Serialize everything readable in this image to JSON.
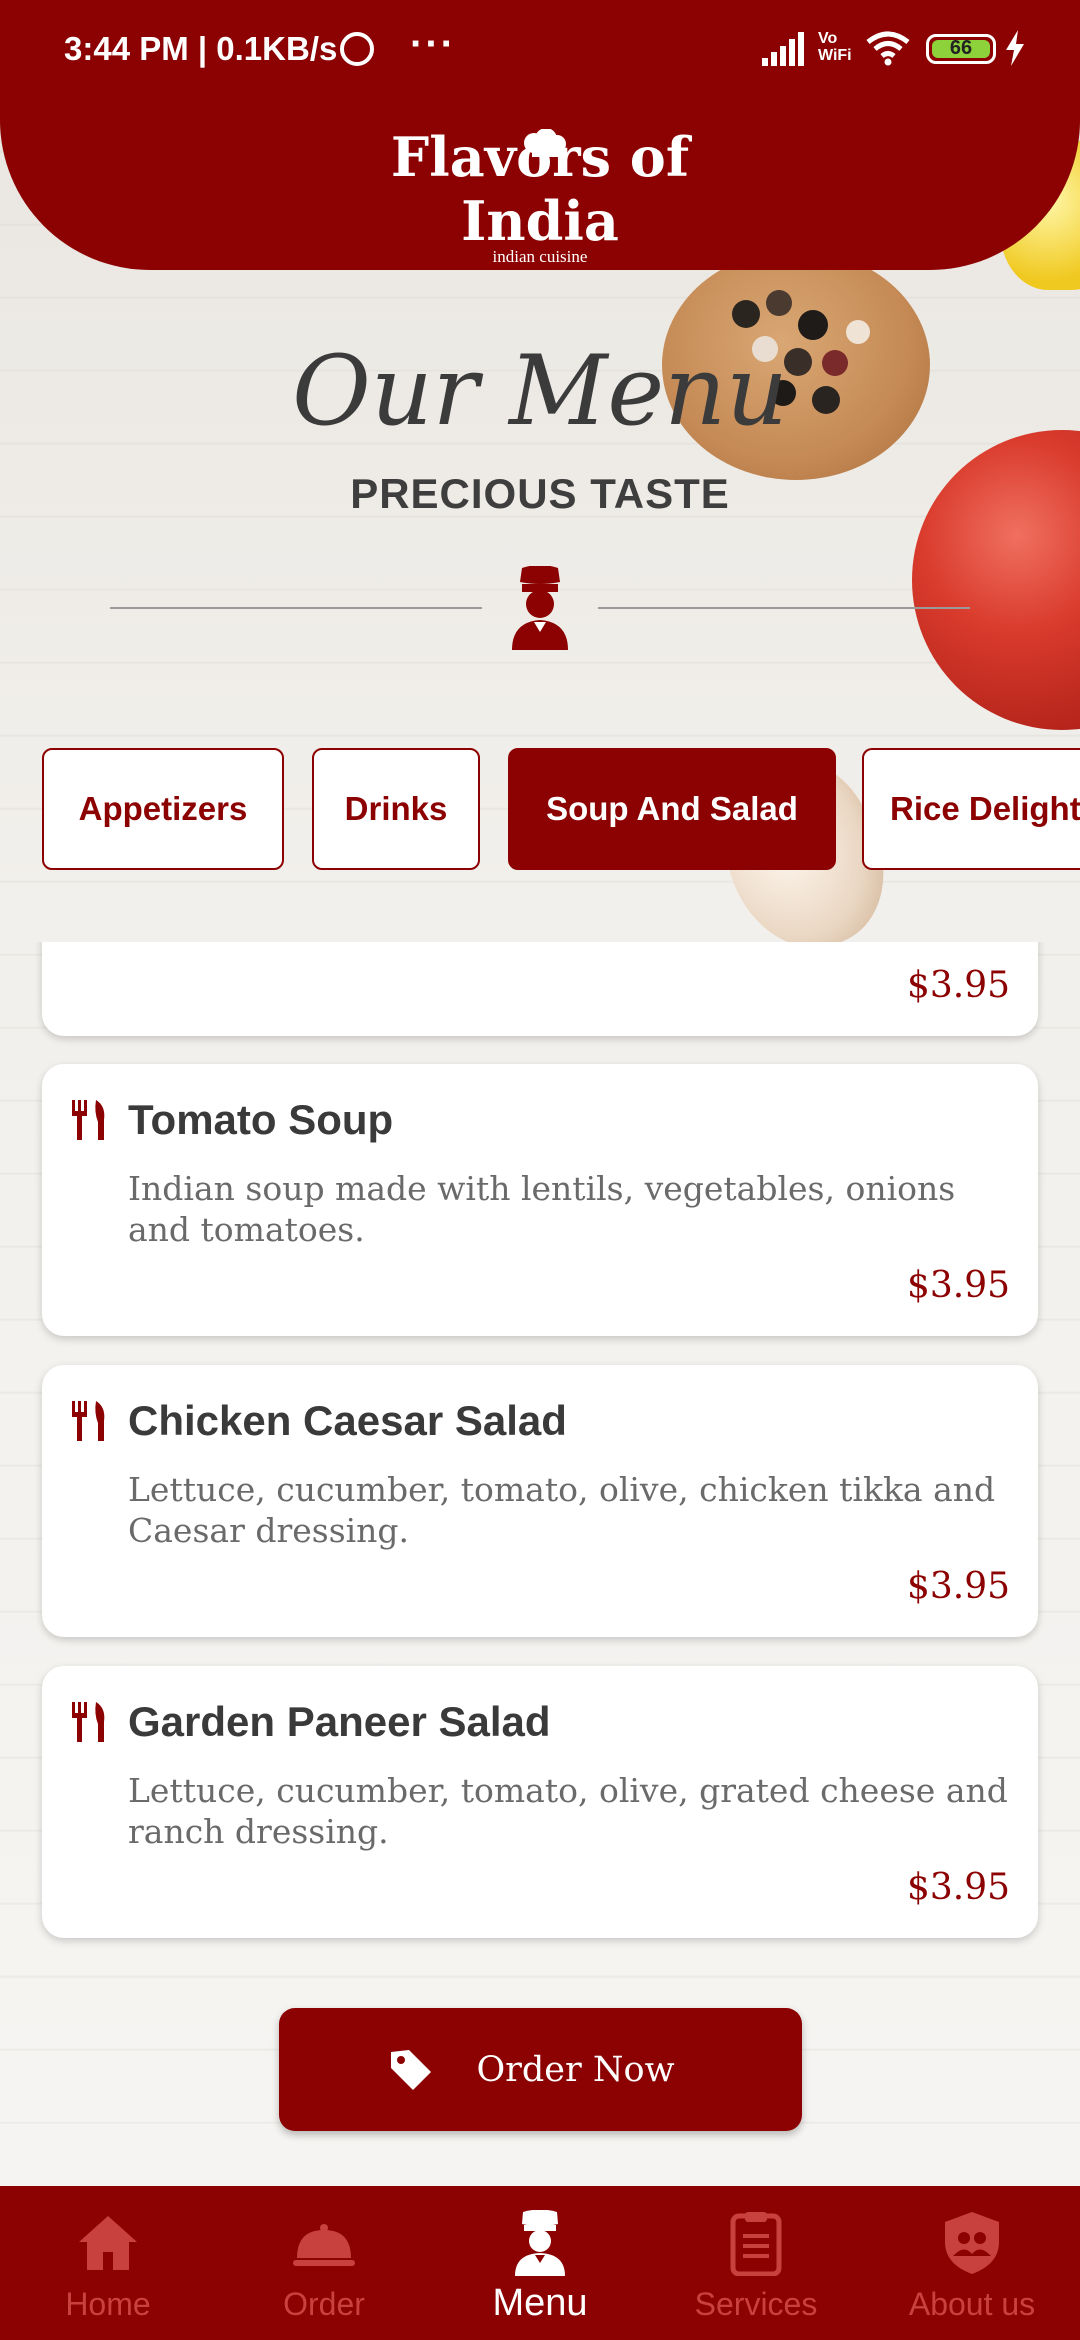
{
  "status_bar": {
    "time": "3:44 PM | 0.1KB/s",
    "dots": "···",
    "vowifi": "Vo\nWiFi",
    "battery": "66"
  },
  "header": {
    "logo_name": "Flavors of India",
    "logo_sub": "indian cuisine"
  },
  "hero": {
    "title": "Our Menu",
    "subtitle": "PRECIOUS TASTE"
  },
  "tabs": [
    {
      "label": "Appetizers",
      "active": false
    },
    {
      "label": "Drinks",
      "active": false
    },
    {
      "label": "Soup And Salad",
      "active": true
    },
    {
      "label": "Rice Delights",
      "active": false
    }
  ],
  "menu_items": [
    {
      "name": "",
      "description": "",
      "price": "$3.95"
    },
    {
      "name": "Tomato Soup",
      "description": "Indian soup made with lentils, vegetables, onions and tomatoes.",
      "price": "$3.95"
    },
    {
      "name": "Chicken Caesar Salad",
      "description": "Lettuce, cucumber, tomato, olive, chicken tikka and Caesar dressing.",
      "price": "$3.95"
    },
    {
      "name": "Garden Paneer Salad",
      "description": "Lettuce, cucumber, tomato, olive, grated cheese and ranch dressing.",
      "price": "$3.95"
    }
  ],
  "order_button": {
    "label": "Order Now"
  },
  "bottom_nav": [
    {
      "label": "Home",
      "icon": "home-icon",
      "active": false
    },
    {
      "label": "Order",
      "icon": "cloche-icon",
      "active": false
    },
    {
      "label": "Menu",
      "icon": "chef-icon",
      "active": true
    },
    {
      "label": "Services",
      "icon": "clipboard-icon",
      "active": false
    },
    {
      "label": "About us",
      "icon": "shield-people-icon",
      "active": false
    }
  ],
  "colors": {
    "brand": "#8c0101",
    "nav_inactive": "#c9413f"
  }
}
